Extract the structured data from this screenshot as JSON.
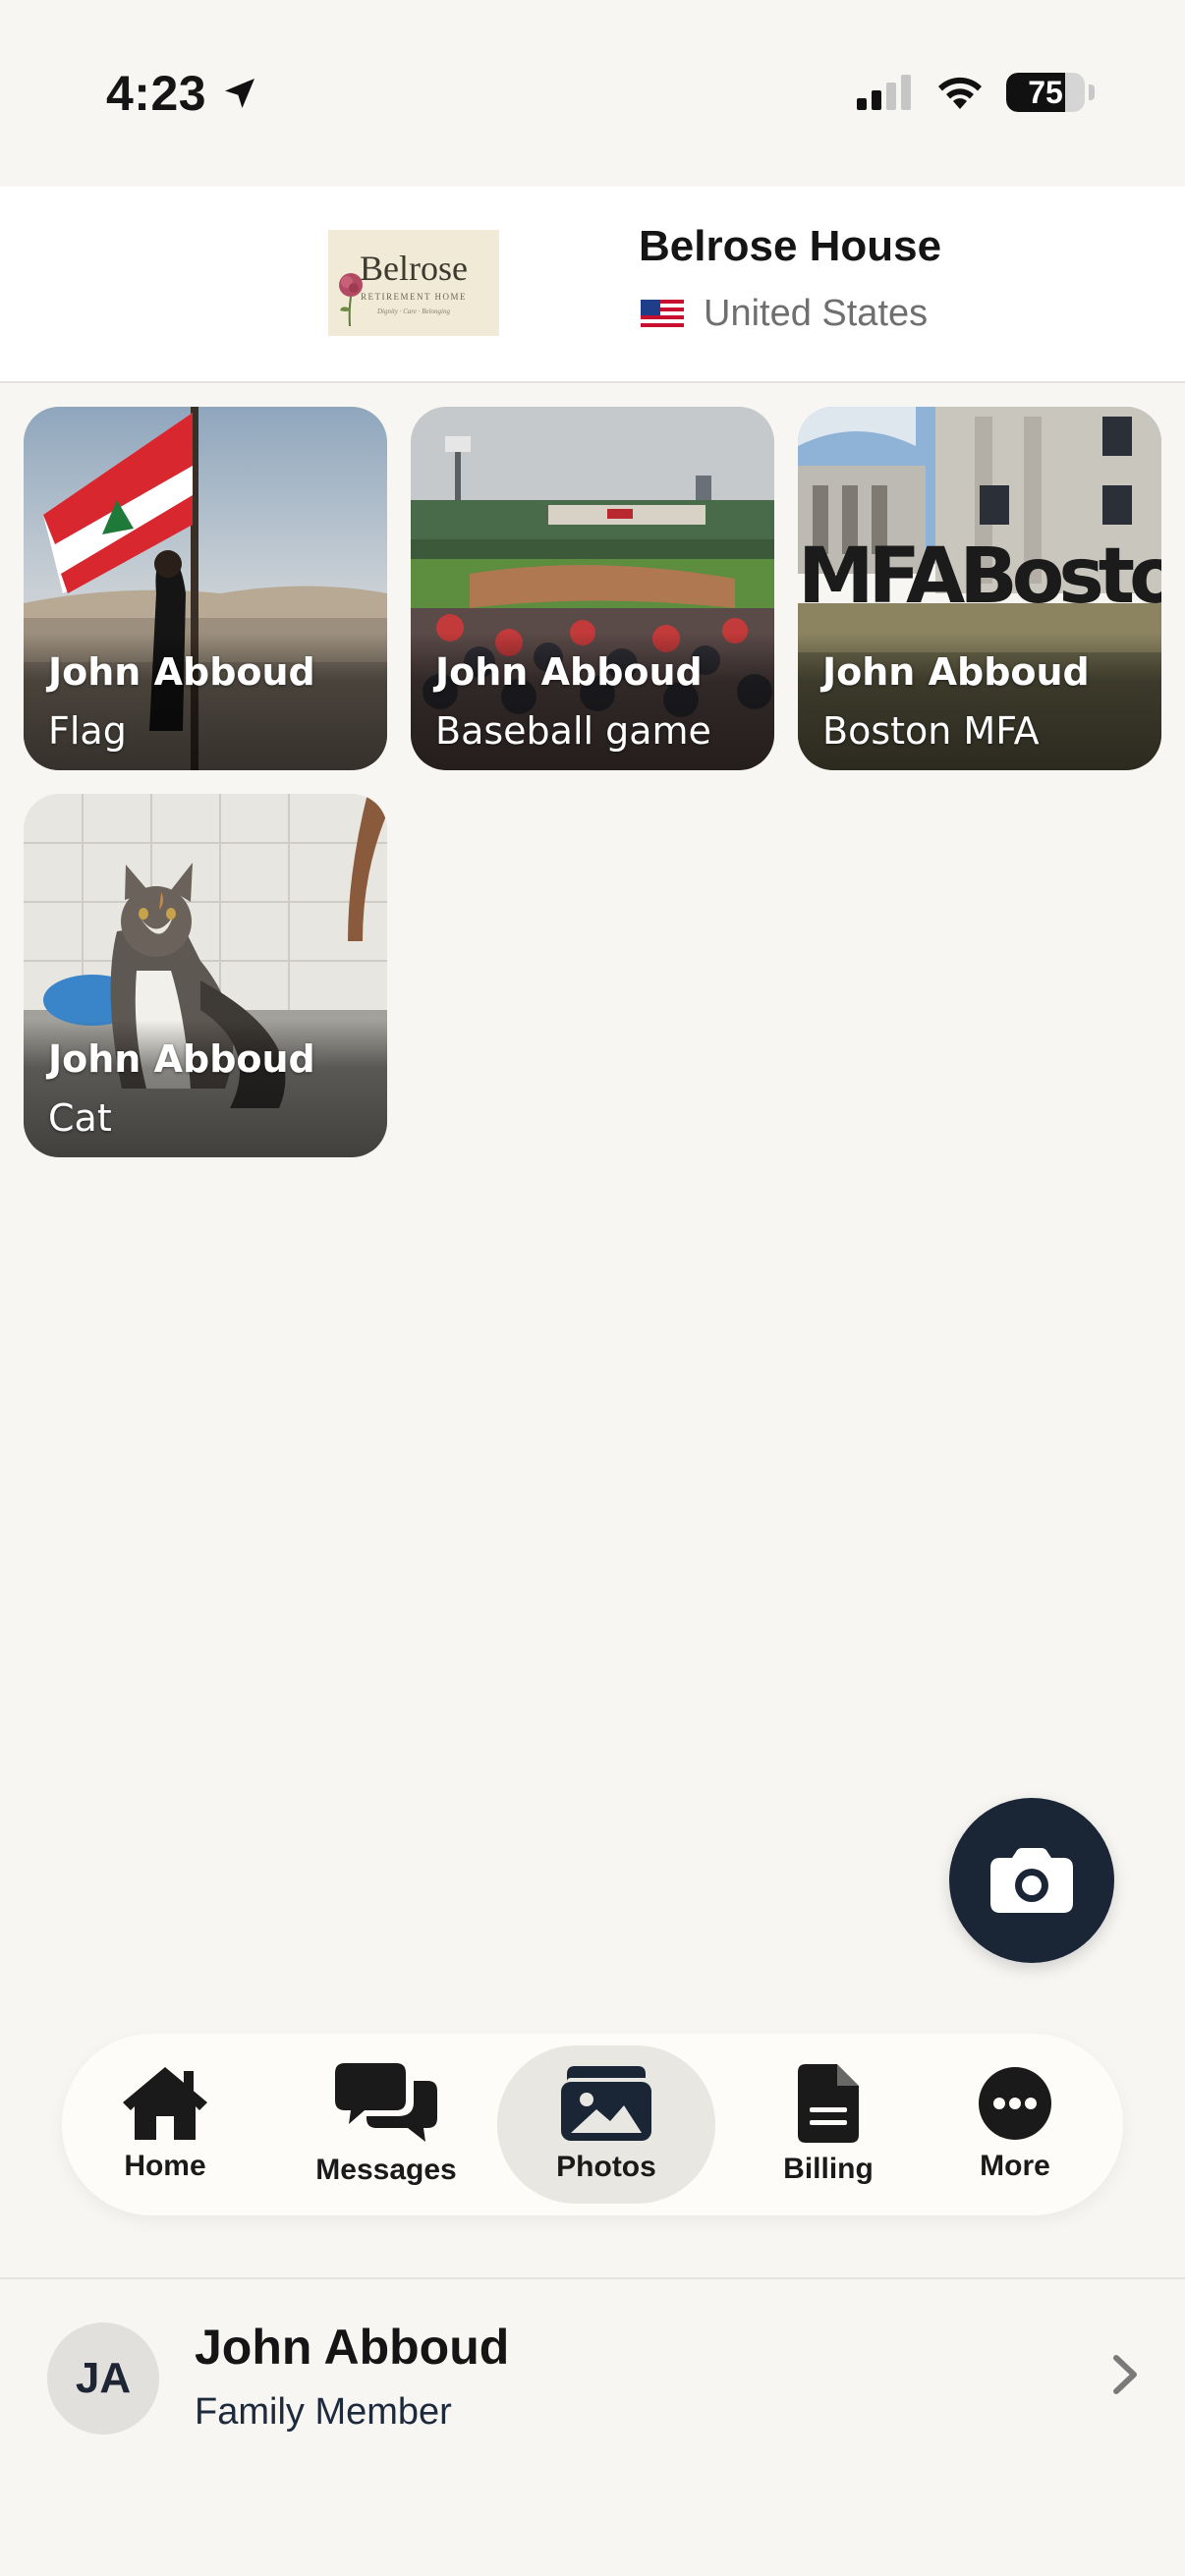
{
  "status_bar": {
    "time": "4:23",
    "battery_percent": "75",
    "battery_level": 0.75
  },
  "header": {
    "logo": {
      "word": "Belrose",
      "subtitle": "RETIREMENT HOME",
      "tagline": "Dignity · Care · Belonging"
    },
    "facility_name": "Belrose House",
    "country_flag_icon": "us-flag-icon",
    "country": "United States"
  },
  "photos": [
    {
      "owner": "John Abboud",
      "title": "Flag"
    },
    {
      "owner": "John Abboud",
      "title": "Baseball game"
    },
    {
      "owner": "John Abboud",
      "title": "Boston MFA",
      "sign_text": "MFABoston"
    },
    {
      "owner": "John Abboud",
      "title": "Cat"
    }
  ],
  "fab": {
    "icon": "camera-icon"
  },
  "tabbar": {
    "items": [
      {
        "label": "Home",
        "icon": "home-icon",
        "active": false
      },
      {
        "label": "Messages",
        "icon": "messages-icon",
        "active": false
      },
      {
        "label": "Photos",
        "icon": "photos-icon",
        "active": true
      },
      {
        "label": "Billing",
        "icon": "billing-icon",
        "active": false
      },
      {
        "label": "More",
        "icon": "more-icon",
        "active": false
      }
    ]
  },
  "user": {
    "initials": "JA",
    "name": "John Abboud",
    "role": "Family Member"
  },
  "colors": {
    "background": "#f7f6f3",
    "accent_dark": "#1a2536",
    "active_tab": "#e9e7e1"
  }
}
